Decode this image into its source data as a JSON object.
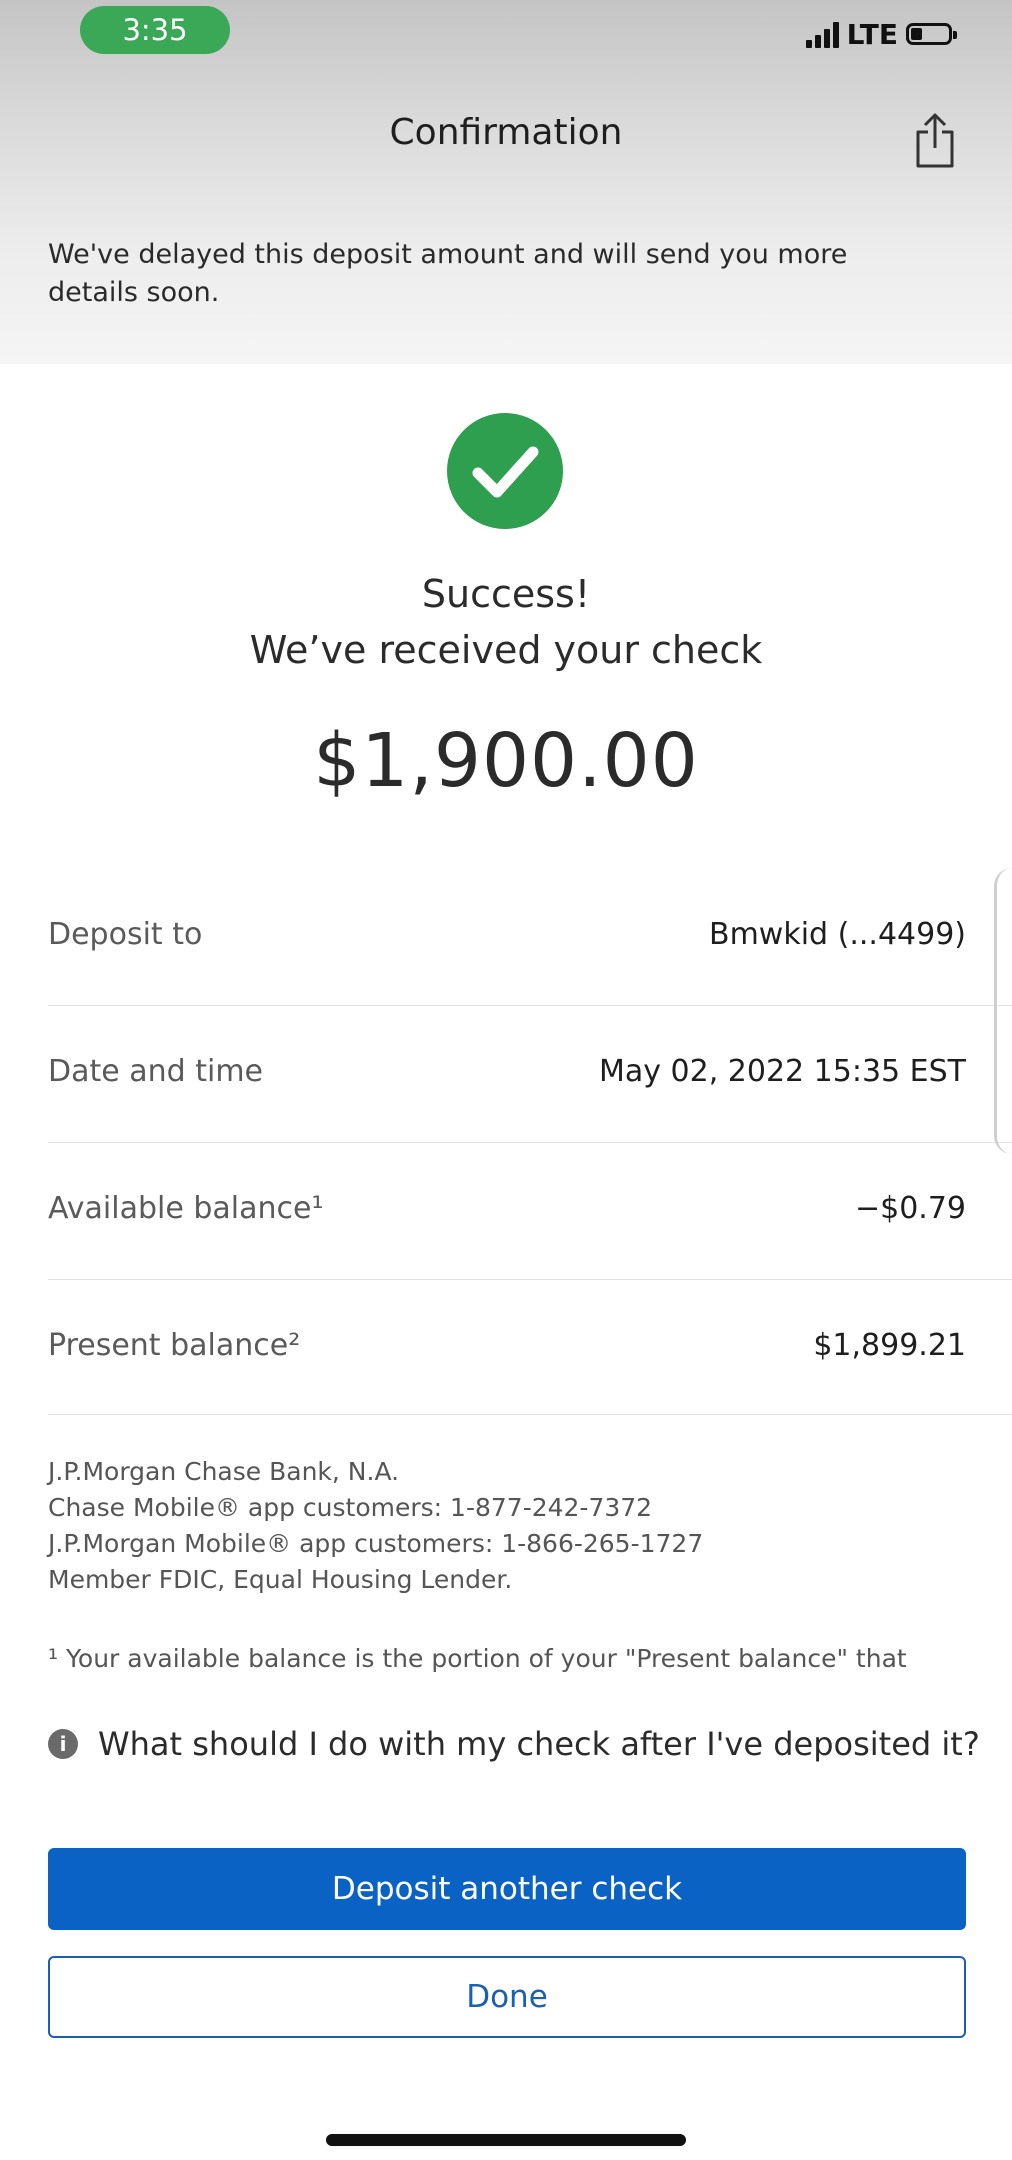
{
  "status_bar": {
    "time": "3:35",
    "network": "LTE"
  },
  "header": {
    "title": "Confirmation"
  },
  "banner": {
    "text": "We've delayed this deposit amount and will send you more details soon."
  },
  "result": {
    "line1": "Success!",
    "line2": "We’ve received your check",
    "amount": "$1,900.00"
  },
  "details": [
    {
      "label": "Deposit to",
      "value": "Bmwkid (...4499)"
    },
    {
      "label": "Date and time",
      "value": "May 02, 2022 15:35 EST"
    },
    {
      "label": "Available balance¹",
      "value": "−$0.79"
    },
    {
      "label": "Present balance²",
      "value": "$1,899.21"
    }
  ],
  "disclosure": [
    "J.P.Morgan Chase Bank, N.A.",
    "Chase Mobile® app customers: 1-877-242-7372",
    "J.P.Morgan Mobile® app customers: 1-866-265-1727",
    "Member FDIC, Equal Housing Lender."
  ],
  "footnote": "¹ Your available balance is the portion of your \"Present balance\" that",
  "faq": {
    "text": "What should I do with my check after I've deposited it?"
  },
  "buttons": {
    "primary": "Deposit another check",
    "secondary": "Done"
  },
  "colors": {
    "success_green": "#2e9e4f",
    "primary_blue": "#0a63c4",
    "time_pill": "#3aa856"
  },
  "icons": {
    "share": "share-icon",
    "success": "checkmark-circle-icon",
    "info": "info-icon"
  }
}
